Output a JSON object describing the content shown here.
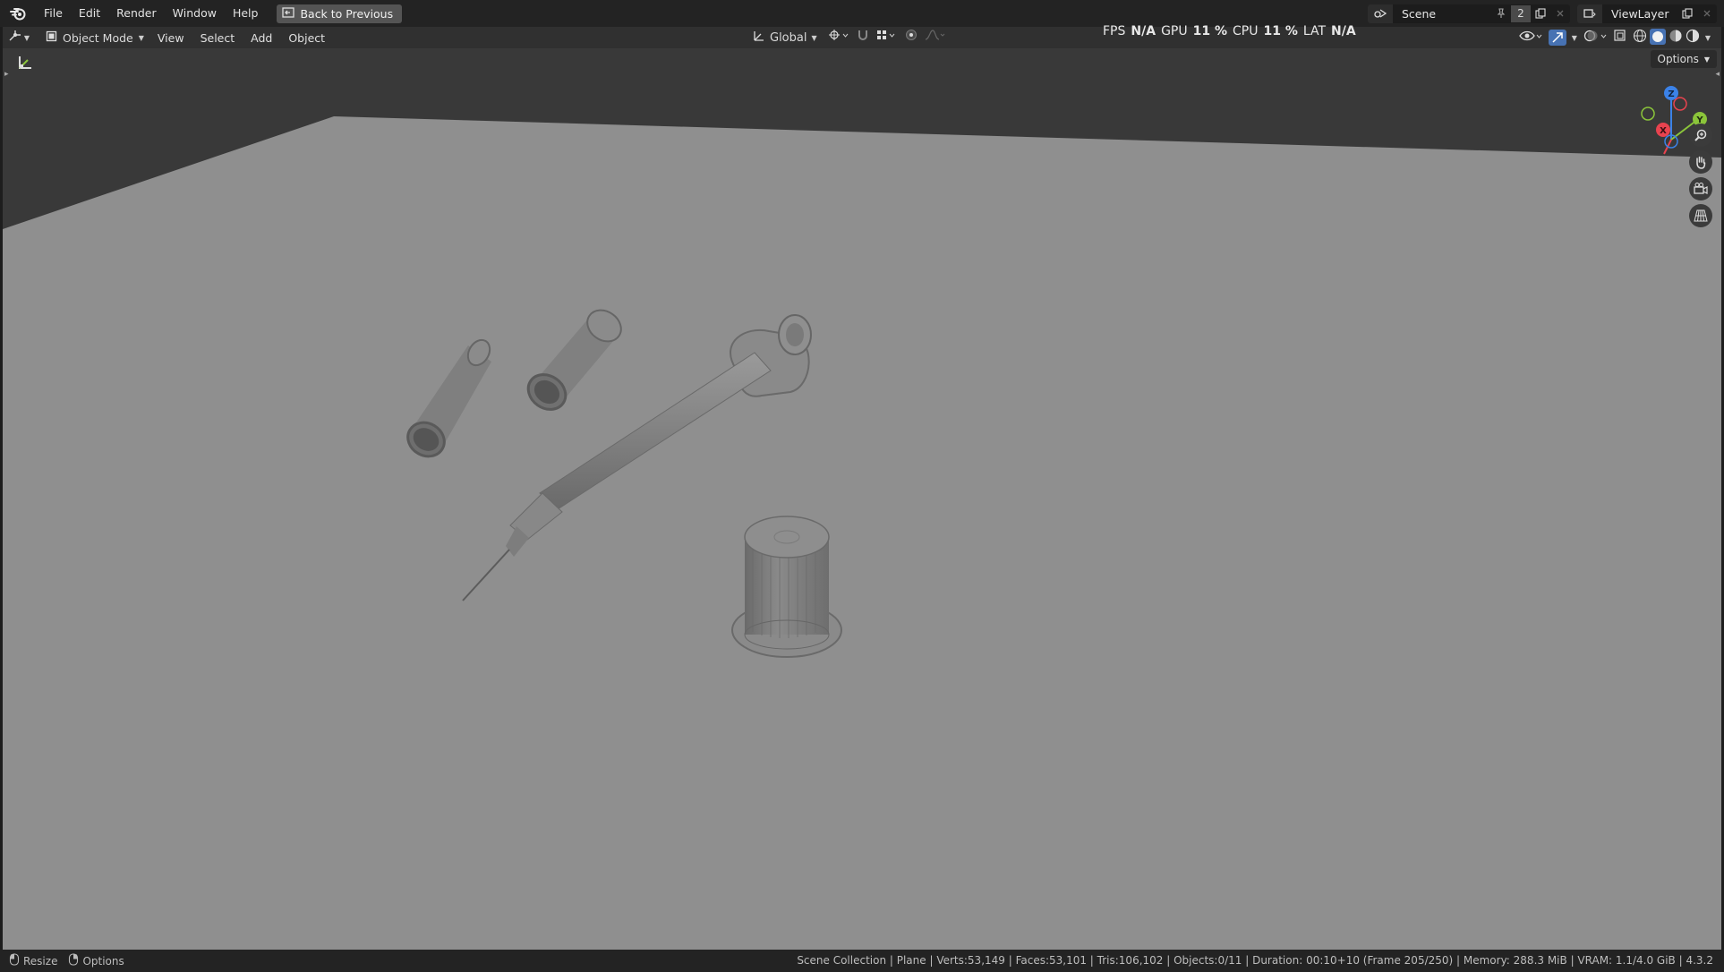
{
  "menu": {
    "items": [
      "File",
      "Edit",
      "Render",
      "Window",
      "Help"
    ],
    "back_button": "Back to Previous"
  },
  "top_right": {
    "scene_name": "Scene",
    "scene_users": "2",
    "view_layer": "ViewLayer"
  },
  "viewport_header": {
    "mode": "Object Mode",
    "menus": [
      "View",
      "Select",
      "Add",
      "Object"
    ],
    "orientation": "Global",
    "options_label": "Options"
  },
  "overlay_stats": {
    "fps_label": "FPS",
    "fps_value": "N/A",
    "gpu_label": "GPU",
    "gpu_value": "11 %",
    "cpu_label": "CPU",
    "cpu_value": "11 %",
    "lat_label": "LAT",
    "lat_value": "N/A"
  },
  "gizmo": {
    "z_label": "Z",
    "y_label": "Y",
    "x_label": "X",
    "colors": {
      "x": "#e8434f",
      "y": "#8bc53a",
      "z": "#3b82e8"
    }
  },
  "statusbar": {
    "resize_label": "Resize",
    "options_label": "Options",
    "info": "Scene Collection | Plane | Verts:53,149 | Faces:53,101 | Tris:106,102 | Objects:0/11 | Duration: 00:10+10 (Frame 205/250) | Memory: 288.3 MiB | VRAM: 1.1/4.0 GiB | 4.3.2"
  },
  "colors": {
    "ground": "#8f8f8f",
    "background": "#393939",
    "object": "#7d7d7d"
  }
}
